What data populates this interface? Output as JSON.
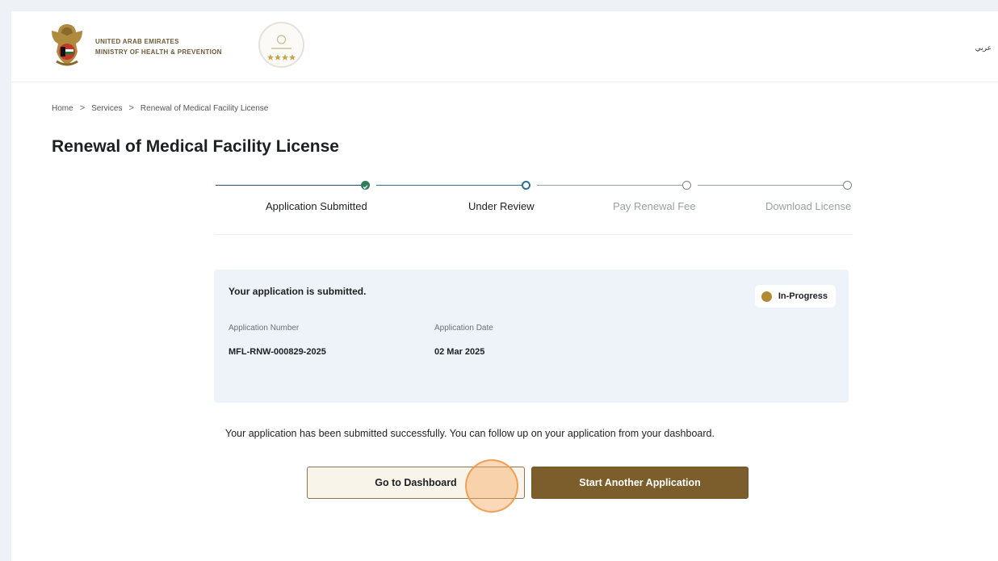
{
  "header": {
    "ministry_line1": "UNITED ARAB EMIRATES",
    "ministry_line2": "MINISTRY OF HEALTH & PREVENTION",
    "language_toggle": "عربي"
  },
  "breadcrumb": {
    "items": [
      "Home",
      "Services",
      "Renewal of Medical Facility License"
    ],
    "separator": ">"
  },
  "page_title": "Renewal of Medical Facility License",
  "stepper": {
    "steps": [
      {
        "label": "Application Submitted",
        "state": "completed"
      },
      {
        "label": "Under Review",
        "state": "current"
      },
      {
        "label": "Pay Renewal Fee",
        "state": "upcoming"
      },
      {
        "label": "Download License",
        "state": "upcoming"
      }
    ]
  },
  "card": {
    "title": "Your application is submitted.",
    "status": "In-Progress",
    "fields": [
      {
        "label": "Application Number",
        "value": "MFL-RNW-000829-2025"
      },
      {
        "label": "Application Date",
        "value": "02 Mar 2025"
      }
    ]
  },
  "message": "Your application has been submitted successfully. You can follow up on your application from your dashboard.",
  "buttons": {
    "dashboard": "Go to Dashboard",
    "start_another": "Start Another Application"
  },
  "colors": {
    "accent": "#7b5e2b",
    "step_completed": "#2e7d5b",
    "step_current": "#2f6f93",
    "status_in_progress": "#b38a34"
  }
}
